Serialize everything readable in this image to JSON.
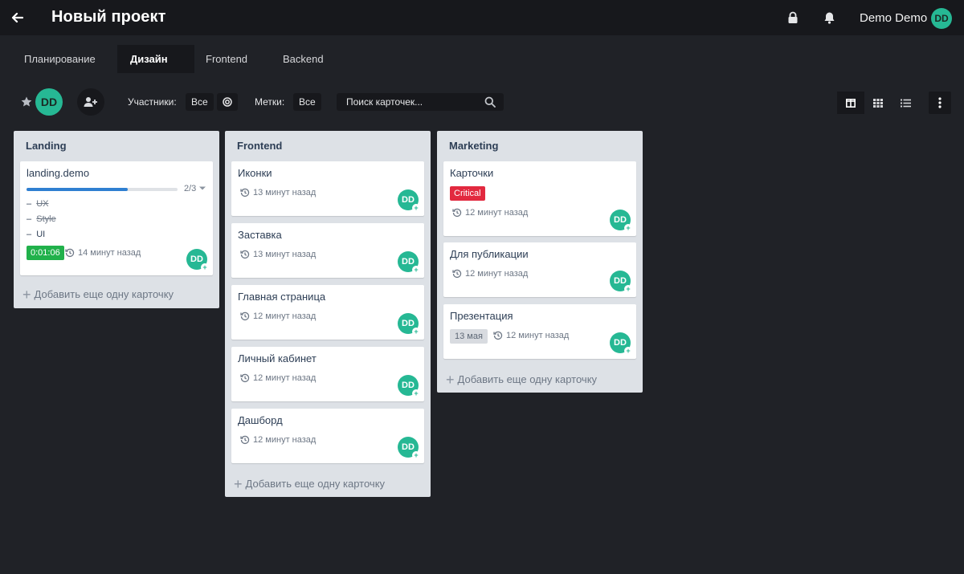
{
  "header": {
    "title": "Новый проект",
    "user_name": "Demo Demo",
    "avatar_initials": "DD",
    "icons": [
      "back-arrow-icon",
      "lock-icon",
      "bell-icon"
    ]
  },
  "tabs": [
    {
      "label": "Планирование",
      "active": false
    },
    {
      "label": "Дизайн",
      "active": true
    },
    {
      "label": "Frontend",
      "active": false
    },
    {
      "label": "Backend",
      "active": false
    }
  ],
  "toolbar": {
    "avatar_initials": "DD",
    "members_label": "Участники:",
    "members_value": "Все",
    "tags_label": "Метки:",
    "tags_value": "Все",
    "search_placeholder": "Поиск карточек..."
  },
  "colors": {
    "background": "#202227",
    "header": "#17181c",
    "avatar": "#26b894",
    "progress": "#2f7fd1",
    "timer": "#21b14b",
    "critical": "#e2293f"
  },
  "columns": [
    {
      "title": "Landing",
      "add_label": "Добавить еще одну карточку",
      "cards": [
        {
          "title": "landing.demo",
          "progress_text": "2/3",
          "progress_fraction": 0.67,
          "checklist": [
            {
              "label": "UX",
              "done": true
            },
            {
              "label": "Style",
              "done": true
            },
            {
              "label": "UI",
              "done": false
            }
          ],
          "timer": "0:01:06",
          "time": "14 минут назад",
          "avatar": "DD"
        }
      ]
    },
    {
      "title": "Frontend",
      "add_label": "Добавить еще одну карточку",
      "cards": [
        {
          "title": "Иконки",
          "time": "13 минут назад",
          "avatar": "DD"
        },
        {
          "title": "Заставка",
          "time": "13 минут назад",
          "avatar": "DD"
        },
        {
          "title": "Главная страница",
          "time": "12 минут назад",
          "avatar": "DD"
        },
        {
          "title": "Личный кабинет",
          "time": "12 минут назад",
          "avatar": "DD"
        },
        {
          "title": "Дашборд",
          "time": "12 минут назад",
          "avatar": "DD"
        }
      ]
    },
    {
      "title": "Marketing",
      "add_label": "Добавить еще одну карточку",
      "cards": [
        {
          "title": "Карточки",
          "badge": "Critical",
          "time": "12 минут назад",
          "avatar": "DD"
        },
        {
          "title": "Для публикации",
          "time": "12 минут назад",
          "avatar": "DD"
        },
        {
          "title": "Презентация",
          "date": "13 мая",
          "time": "12 минут назад",
          "avatar": "DD"
        }
      ]
    }
  ]
}
